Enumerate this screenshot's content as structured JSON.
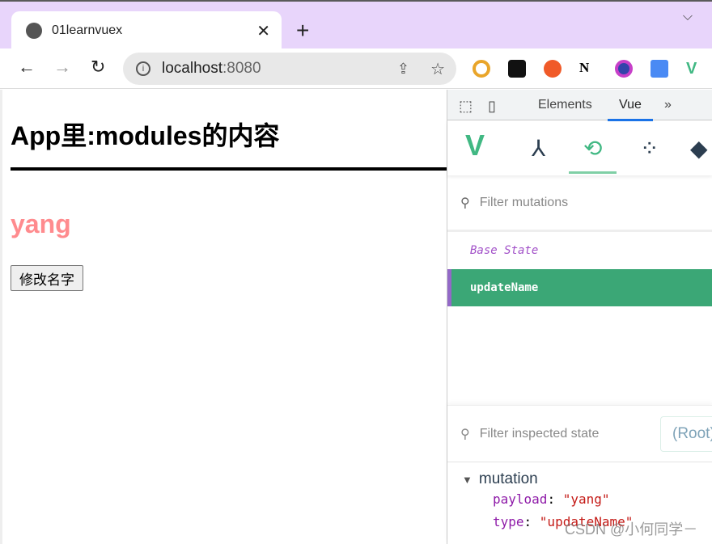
{
  "browser": {
    "tab_title": "01learnvuex",
    "address_host": "localhost",
    "address_port": ":8080",
    "extensions": [
      "chrome-icon",
      "tampermonkey-icon",
      "infinity-icon",
      "notion-icon",
      "camera-icon",
      "google-translate-icon",
      "vue-devtools-icon"
    ]
  },
  "page": {
    "heading": "App里:modules的内容",
    "name": "yang",
    "button": "修改名字",
    "name_color": "#ff8b8e"
  },
  "devtools": {
    "tabs": [
      "Elements",
      "Vue",
      "»"
    ],
    "active_tab": "Vue",
    "mutations_placeholder": "Filter mutations",
    "mutations": [
      {
        "label": "Base State"
      },
      {
        "label": "updateName",
        "selected": true
      }
    ],
    "state_placeholder": "Filter inspected state",
    "root_select": "(Root)",
    "section": "mutation",
    "fields": [
      {
        "key": "payload",
        "value": "\"yang\""
      },
      {
        "key": "type",
        "value": "\"updateName\""
      }
    ],
    "accent": "#3ba776"
  },
  "watermark": "CSDN @小何同学－"
}
